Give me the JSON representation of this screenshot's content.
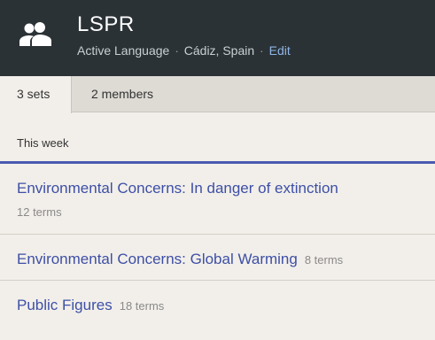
{
  "header": {
    "title": "LSPR",
    "meta_language": "Active Language",
    "meta_sep": "·",
    "meta_location": "Cádiz, Spain",
    "meta_edit": "Edit",
    "icon": "people-icon"
  },
  "tabs": [
    {
      "label": "3 sets",
      "active": true
    },
    {
      "label": "2 members",
      "active": false
    }
  ],
  "section": {
    "title": "This week"
  },
  "sets": [
    {
      "name": "Environmental Concerns: In danger of extinction",
      "terms": "12 terms"
    },
    {
      "name": "Environmental Concerns: Global Warming",
      "terms": "8 terms"
    },
    {
      "name": "Public Figures",
      "terms": "18 terms"
    }
  ],
  "colors": {
    "header_bg": "#2b3236",
    "link": "#3d4fa6",
    "accent_rule": "#4b5ab0",
    "edit_link": "#8fb6e6"
  }
}
